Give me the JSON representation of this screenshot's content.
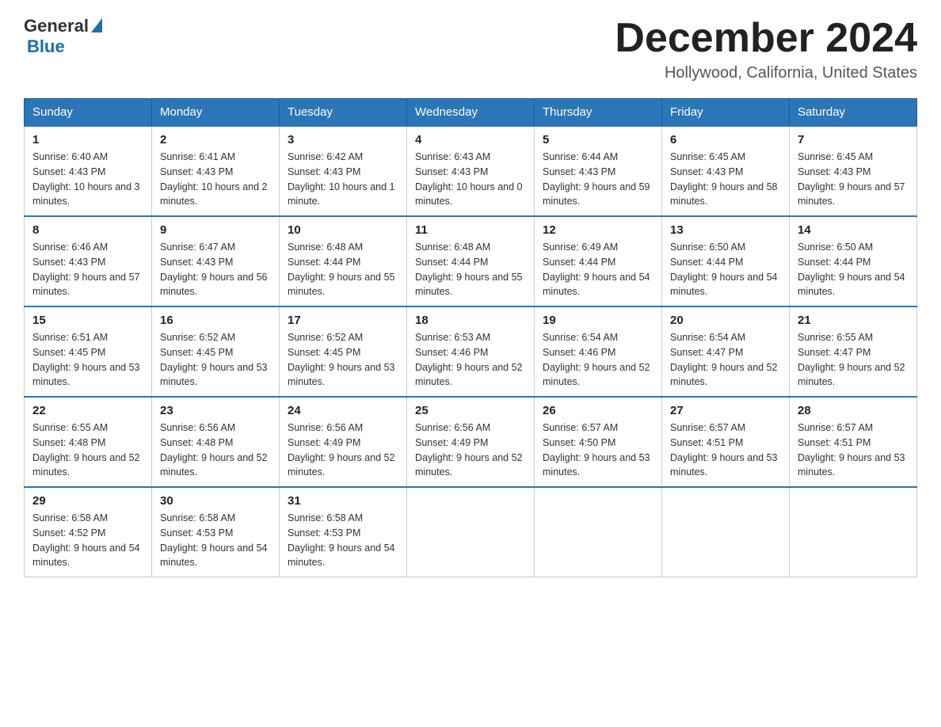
{
  "header": {
    "logo": {
      "general": "General",
      "blue": "Blue"
    },
    "title": "December 2024",
    "location": "Hollywood, California, United States"
  },
  "weekdays": [
    "Sunday",
    "Monday",
    "Tuesday",
    "Wednesday",
    "Thursday",
    "Friday",
    "Saturday"
  ],
  "weeks": [
    [
      {
        "day": "1",
        "sunrise": "6:40 AM",
        "sunset": "4:43 PM",
        "daylight": "10 hours and 3 minutes."
      },
      {
        "day": "2",
        "sunrise": "6:41 AM",
        "sunset": "4:43 PM",
        "daylight": "10 hours and 2 minutes."
      },
      {
        "day": "3",
        "sunrise": "6:42 AM",
        "sunset": "4:43 PM",
        "daylight": "10 hours and 1 minute."
      },
      {
        "day": "4",
        "sunrise": "6:43 AM",
        "sunset": "4:43 PM",
        "daylight": "10 hours and 0 minutes."
      },
      {
        "day": "5",
        "sunrise": "6:44 AM",
        "sunset": "4:43 PM",
        "daylight": "9 hours and 59 minutes."
      },
      {
        "day": "6",
        "sunrise": "6:45 AM",
        "sunset": "4:43 PM",
        "daylight": "9 hours and 58 minutes."
      },
      {
        "day": "7",
        "sunrise": "6:45 AM",
        "sunset": "4:43 PM",
        "daylight": "9 hours and 57 minutes."
      }
    ],
    [
      {
        "day": "8",
        "sunrise": "6:46 AM",
        "sunset": "4:43 PM",
        "daylight": "9 hours and 57 minutes."
      },
      {
        "day": "9",
        "sunrise": "6:47 AM",
        "sunset": "4:43 PM",
        "daylight": "9 hours and 56 minutes."
      },
      {
        "day": "10",
        "sunrise": "6:48 AM",
        "sunset": "4:44 PM",
        "daylight": "9 hours and 55 minutes."
      },
      {
        "day": "11",
        "sunrise": "6:48 AM",
        "sunset": "4:44 PM",
        "daylight": "9 hours and 55 minutes."
      },
      {
        "day": "12",
        "sunrise": "6:49 AM",
        "sunset": "4:44 PM",
        "daylight": "9 hours and 54 minutes."
      },
      {
        "day": "13",
        "sunrise": "6:50 AM",
        "sunset": "4:44 PM",
        "daylight": "9 hours and 54 minutes."
      },
      {
        "day": "14",
        "sunrise": "6:50 AM",
        "sunset": "4:44 PM",
        "daylight": "9 hours and 54 minutes."
      }
    ],
    [
      {
        "day": "15",
        "sunrise": "6:51 AM",
        "sunset": "4:45 PM",
        "daylight": "9 hours and 53 minutes."
      },
      {
        "day": "16",
        "sunrise": "6:52 AM",
        "sunset": "4:45 PM",
        "daylight": "9 hours and 53 minutes."
      },
      {
        "day": "17",
        "sunrise": "6:52 AM",
        "sunset": "4:45 PM",
        "daylight": "9 hours and 53 minutes."
      },
      {
        "day": "18",
        "sunrise": "6:53 AM",
        "sunset": "4:46 PM",
        "daylight": "9 hours and 52 minutes."
      },
      {
        "day": "19",
        "sunrise": "6:54 AM",
        "sunset": "4:46 PM",
        "daylight": "9 hours and 52 minutes."
      },
      {
        "day": "20",
        "sunrise": "6:54 AM",
        "sunset": "4:47 PM",
        "daylight": "9 hours and 52 minutes."
      },
      {
        "day": "21",
        "sunrise": "6:55 AM",
        "sunset": "4:47 PM",
        "daylight": "9 hours and 52 minutes."
      }
    ],
    [
      {
        "day": "22",
        "sunrise": "6:55 AM",
        "sunset": "4:48 PM",
        "daylight": "9 hours and 52 minutes."
      },
      {
        "day": "23",
        "sunrise": "6:56 AM",
        "sunset": "4:48 PM",
        "daylight": "9 hours and 52 minutes."
      },
      {
        "day": "24",
        "sunrise": "6:56 AM",
        "sunset": "4:49 PM",
        "daylight": "9 hours and 52 minutes."
      },
      {
        "day": "25",
        "sunrise": "6:56 AM",
        "sunset": "4:49 PM",
        "daylight": "9 hours and 52 minutes."
      },
      {
        "day": "26",
        "sunrise": "6:57 AM",
        "sunset": "4:50 PM",
        "daylight": "9 hours and 53 minutes."
      },
      {
        "day": "27",
        "sunrise": "6:57 AM",
        "sunset": "4:51 PM",
        "daylight": "9 hours and 53 minutes."
      },
      {
        "day": "28",
        "sunrise": "6:57 AM",
        "sunset": "4:51 PM",
        "daylight": "9 hours and 53 minutes."
      }
    ],
    [
      {
        "day": "29",
        "sunrise": "6:58 AM",
        "sunset": "4:52 PM",
        "daylight": "9 hours and 54 minutes."
      },
      {
        "day": "30",
        "sunrise": "6:58 AM",
        "sunset": "4:53 PM",
        "daylight": "9 hours and 54 minutes."
      },
      {
        "day": "31",
        "sunrise": "6:58 AM",
        "sunset": "4:53 PM",
        "daylight": "9 hours and 54 minutes."
      },
      null,
      null,
      null,
      null
    ]
  ]
}
